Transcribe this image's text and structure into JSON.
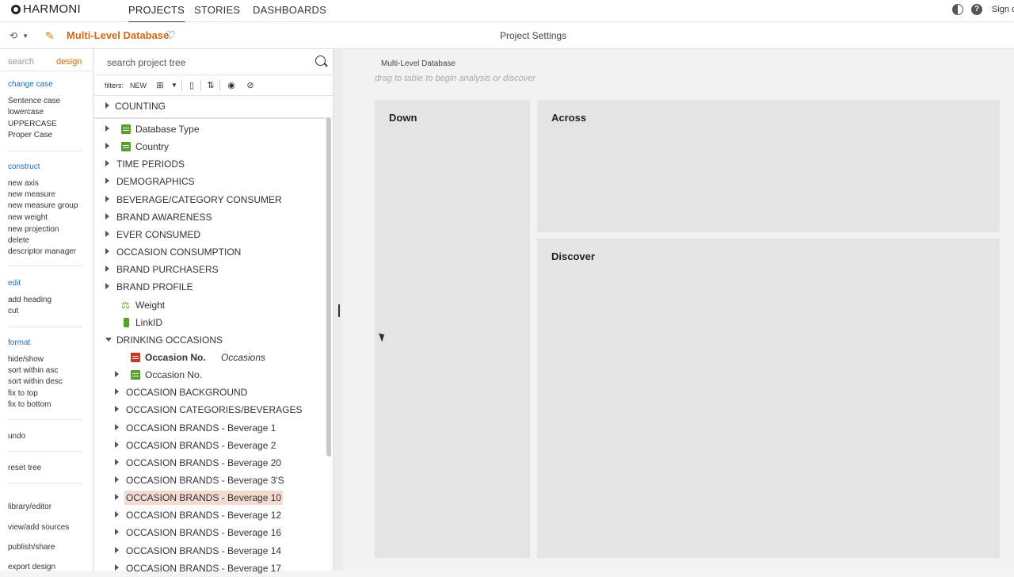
{
  "brand": {
    "name": "HARMONI"
  },
  "nav": {
    "projects": "PROJECTS",
    "stories": "STORIES",
    "dashboards": "DASHBOARDS",
    "signin": "Sign o"
  },
  "header": {
    "db_title": "Multi-Level Database",
    "project_settings": "Project Settings"
  },
  "left_panel": {
    "tabs": {
      "search": "search",
      "design": "design"
    },
    "change_case": {
      "title": "change case",
      "items": [
        "Sentence case",
        "lowercase",
        "UPPERCASE",
        "Proper Case"
      ]
    },
    "construct": {
      "title": "construct",
      "items": [
        "new axis",
        "new measure",
        "new measure group",
        "new weight",
        "new projection",
        "delete",
        "descriptor manager"
      ]
    },
    "edit": {
      "title": "edit",
      "items": [
        "add heading",
        "cut"
      ]
    },
    "format": {
      "title": "format",
      "items": [
        "hide/show",
        "sort within asc",
        "sort within desc",
        "fix to top",
        "fix to bottom"
      ]
    },
    "undo": "undo",
    "reset_tree": "reset tree",
    "bottom": [
      "library/editor",
      "view/add sources",
      "publish/share",
      "export design"
    ]
  },
  "tree": {
    "search_placeholder": "search project tree",
    "filters_label": "filters:",
    "filters_new": "NEW",
    "counting": "COUNTING",
    "rows": [
      {
        "label": "Database Type",
        "indent": 1,
        "icon": "variable"
      },
      {
        "label": "Country",
        "indent": 1,
        "icon": "variable"
      },
      {
        "label": "TIME PERIODS",
        "indent": 0
      },
      {
        "label": "DEMOGRAPHICS",
        "indent": 0
      },
      {
        "label": "BEVERAGE/CATEGORY CONSUMER",
        "indent": 0
      },
      {
        "label": "BRAND AWARENESS",
        "indent": 0
      },
      {
        "label": "EVER CONSUMED",
        "indent": 0
      },
      {
        "label": "OCCASION CONSUMPTION",
        "indent": 0
      },
      {
        "label": "BRAND PURCHASERS",
        "indent": 0
      },
      {
        "label": "BRAND PROFILE",
        "indent": 0
      },
      {
        "label": "Weight",
        "indent": 1,
        "icon": "weight",
        "leaf": true
      },
      {
        "label": "LinkID",
        "indent": 1,
        "icon": "link",
        "leaf": true
      },
      {
        "label": "DRINKING OCCASIONS",
        "indent": 0,
        "open": true
      },
      {
        "label": "Occasion No.",
        "suffix": "Occasions",
        "indent": 2,
        "icon": "red-variable",
        "leaf": true,
        "bold": true
      },
      {
        "label": "Occasion No.",
        "indent": 2,
        "icon": "variable"
      },
      {
        "label": "OCCASION BACKGROUND",
        "indent": 2
      },
      {
        "label": "OCCASION CATEGORIES/BEVERAGES",
        "indent": 2
      },
      {
        "label": "OCCASION BRANDS - Beverage 1",
        "indent": 2
      },
      {
        "label": "OCCASION BRANDS - Beverage 2",
        "indent": 2
      },
      {
        "label": "OCCASION BRANDS - Beverage 20",
        "indent": 2
      },
      {
        "label": "OCCASION BRANDS - Beverage 3'S",
        "indent": 2
      },
      {
        "label": "OCCASION BRANDS - Beverage 10",
        "indent": 2,
        "highlight": true
      },
      {
        "label": "OCCASION BRANDS - Beverage 12",
        "indent": 2
      },
      {
        "label": "OCCASION BRANDS - Beverage 16",
        "indent": 2
      },
      {
        "label": "OCCASION BRANDS - Beverage 14",
        "indent": 2
      },
      {
        "label": "OCCASION BRANDS - Beverage 17",
        "indent": 2
      }
    ]
  },
  "canvas": {
    "title": "Multi-Level Database",
    "hint": "drag to table to begin analysis or discover",
    "down": "Down",
    "across": "Across",
    "discover": "Discover"
  },
  "colors": {
    "accent": "#d26a16",
    "link": "#1f6fb5",
    "node_green": "#5a9e2b",
    "highlight": "#f3dbcf"
  }
}
